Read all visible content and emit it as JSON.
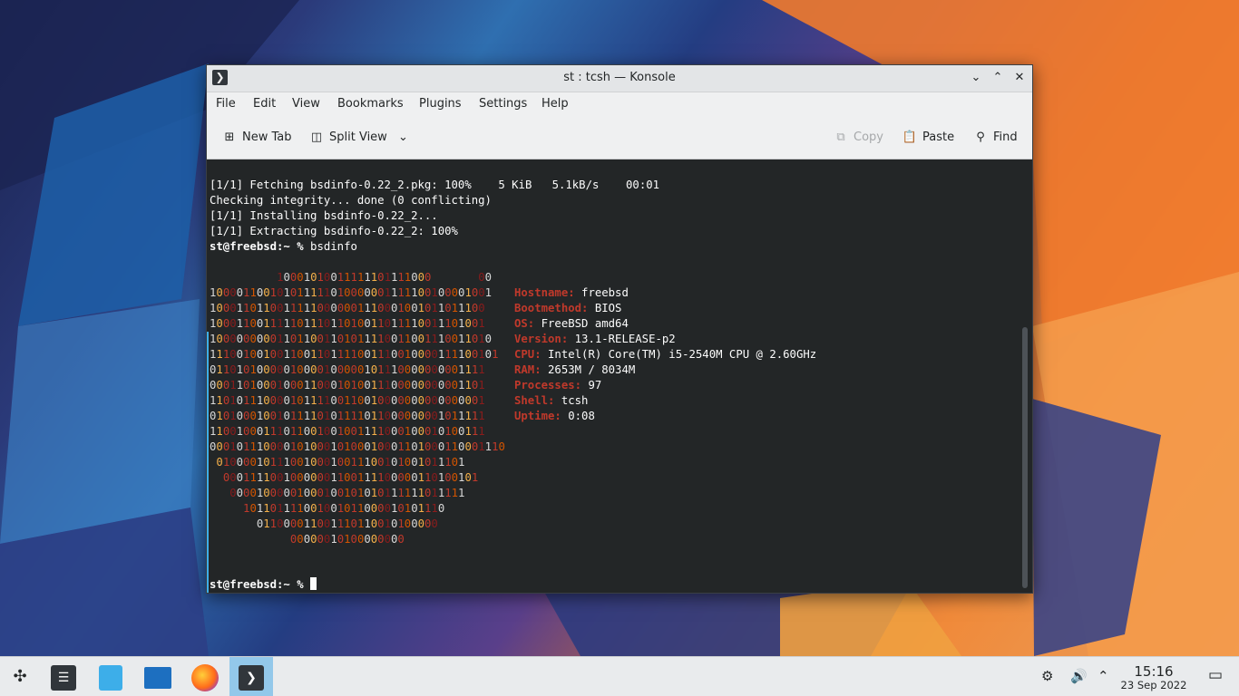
{
  "window": {
    "title": "st : tcsh — Konsole",
    "menu": [
      "File",
      "Edit",
      "View",
      "Bookmarks",
      "Plugins",
      "Settings",
      "Help"
    ],
    "toolbar": {
      "new_tab": "New Tab",
      "split_view": "Split View",
      "copy": "Copy",
      "paste": "Paste",
      "find": "Find"
    }
  },
  "terminal": {
    "lines": [
      "[1/1] Fetching bsdinfo-0.22_2.pkg: 100%    5 KiB   5.1kB/s    00:01",
      "Checking integrity... done (0 conflicting)",
      "[1/1] Installing bsdinfo-0.22_2...",
      "[1/1] Extracting bsdinfo-0.22_2: 100%"
    ],
    "prompt": "st@freebsd:~ %",
    "command": " bsdinfo",
    "art": [
      "          10001010011111101111000       00",
      "100001100101011111010000001111100100001001",
      "10001101100111110000001110001001011011100",
      "10001100111110111011010011011110011101001",
      "100000000011011001101011110011001110011010",
      "1110010010011001101111001110010000111100101",
      "01101010000010000100000101110000000001111",
      "00011010001000110001010011100000000001101",
      "11010111000010111100110010000000000000001",
      "01010001001011110101111011000000001011111",
      "11001000111011001001001111000100010100111",
      "00010111000010100010100010001101000110001110",
      " 0100001011100100010011100101001011101",
      "  00011110010000001100111100000110100101",
      "   00001000001000100101010111111011111",
      "     101101111001001011000010101110",
      "       011000011001110110010100000",
      "            00000010100000000"
    ],
    "info": [
      {
        "key": "Hostname:",
        "value": " freebsd"
      },
      {
        "key": "Bootmethod:",
        "value": " BIOS"
      },
      {
        "key": "OS:",
        "value": " FreeBSD amd64"
      },
      {
        "key": "Version:",
        "value": " 13.1-RELEASE-p2"
      },
      {
        "key": "CPU:",
        "value": " Intel(R) Core(TM) i5-2540M CPU @ 2.60GHz"
      },
      {
        "key": "RAM:",
        "value": " 2653M / 8034M"
      },
      {
        "key": "Processes:",
        "value": " 97"
      },
      {
        "key": "Shell:",
        "value": " tcsh"
      },
      {
        "key": "Uptime:",
        "value": " 0:08"
      }
    ],
    "final_prompt": "st@freebsd:~ %"
  },
  "taskbar": {
    "time": "15:16",
    "date": "23 Sep 2022",
    "apps": [
      "application-launcher-icon",
      "system-settings-icon",
      "discover-icon",
      "dolphin-icon",
      "firefox-icon",
      "konsole-icon"
    ]
  },
  "colors": {
    "accent": "#3daee9",
    "terminal_bg": "#232627",
    "info_key": "#c0392b"
  }
}
